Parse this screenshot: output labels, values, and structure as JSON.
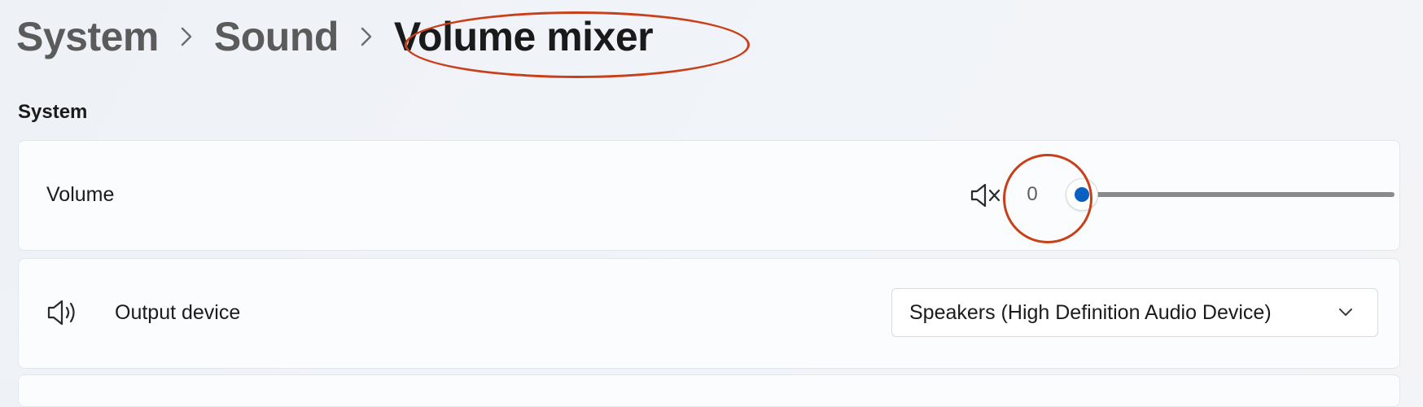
{
  "breadcrumb": {
    "items": [
      "System",
      "Sound"
    ],
    "current": "Volume mixer"
  },
  "system_section": {
    "heading": "System",
    "volume": {
      "label": "Volume",
      "value": "0",
      "level": 0,
      "muted": true,
      "icon": "speaker-muted-icon"
    },
    "output_device": {
      "label": "Output device",
      "icon": "speaker-icon",
      "selected": "Speakers (High Definition Audio Device)"
    }
  },
  "colors": {
    "accent": "#0a5fc2",
    "annotation": "#c8401a",
    "track": "#8a8a8a"
  }
}
